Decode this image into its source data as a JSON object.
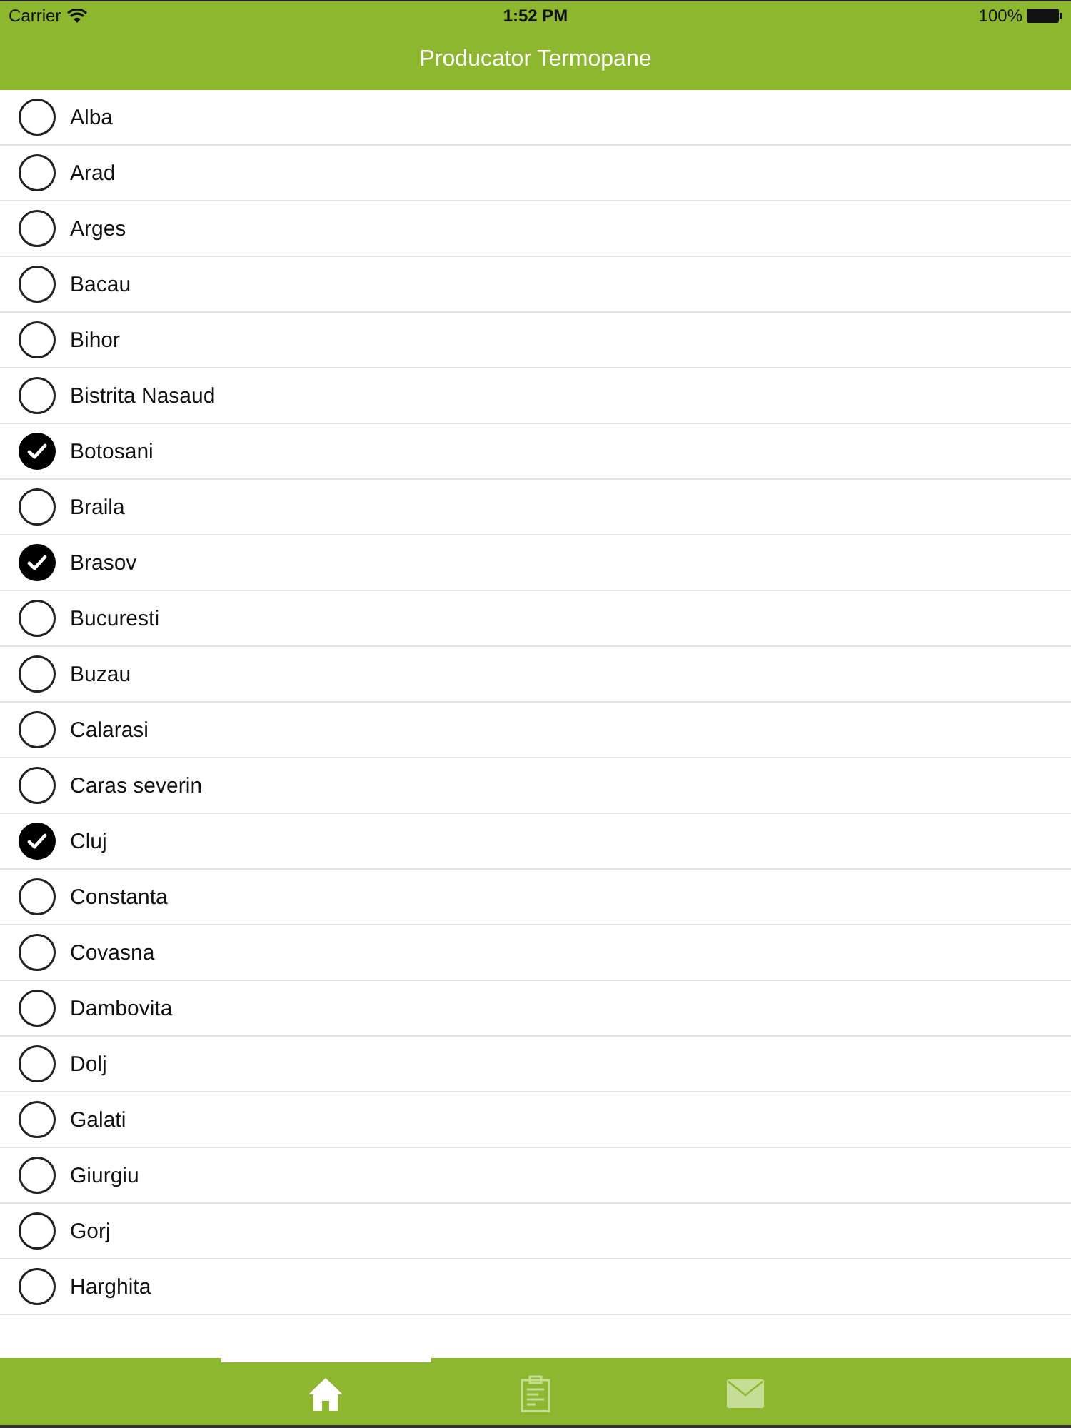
{
  "status_bar": {
    "carrier": "Carrier",
    "time": "1:52 PM",
    "battery": "100%"
  },
  "nav_bar": {
    "title": "Producator Termopane"
  },
  "counties": [
    {
      "name": "Alba",
      "checked": false
    },
    {
      "name": "Arad",
      "checked": false
    },
    {
      "name": "Arges",
      "checked": false
    },
    {
      "name": "Bacau",
      "checked": false
    },
    {
      "name": "Bihor",
      "checked": false
    },
    {
      "name": "Bistrita Nasaud",
      "checked": false
    },
    {
      "name": "Botosani",
      "checked": true
    },
    {
      "name": "Braila",
      "checked": false
    },
    {
      "name": "Brasov",
      "checked": true
    },
    {
      "name": "Bucuresti",
      "checked": false
    },
    {
      "name": "Buzau",
      "checked": false
    },
    {
      "name": "Calarasi",
      "checked": false
    },
    {
      "name": "Caras severin",
      "checked": false
    },
    {
      "name": "Cluj",
      "checked": true
    },
    {
      "name": "Constanta",
      "checked": false
    },
    {
      "name": "Covasna",
      "checked": false
    },
    {
      "name": "Dambovita",
      "checked": false
    },
    {
      "name": "Dolj",
      "checked": false
    },
    {
      "name": "Galati",
      "checked": false
    },
    {
      "name": "Giurgiu",
      "checked": false
    },
    {
      "name": "Gorj",
      "checked": false
    },
    {
      "name": "Harghita",
      "checked": false
    }
  ],
  "tab_bar": {
    "tabs": [
      {
        "kind": "home",
        "selected": true
      },
      {
        "kind": "clipboard",
        "selected": false
      },
      {
        "kind": "mail",
        "selected": false
      }
    ]
  }
}
